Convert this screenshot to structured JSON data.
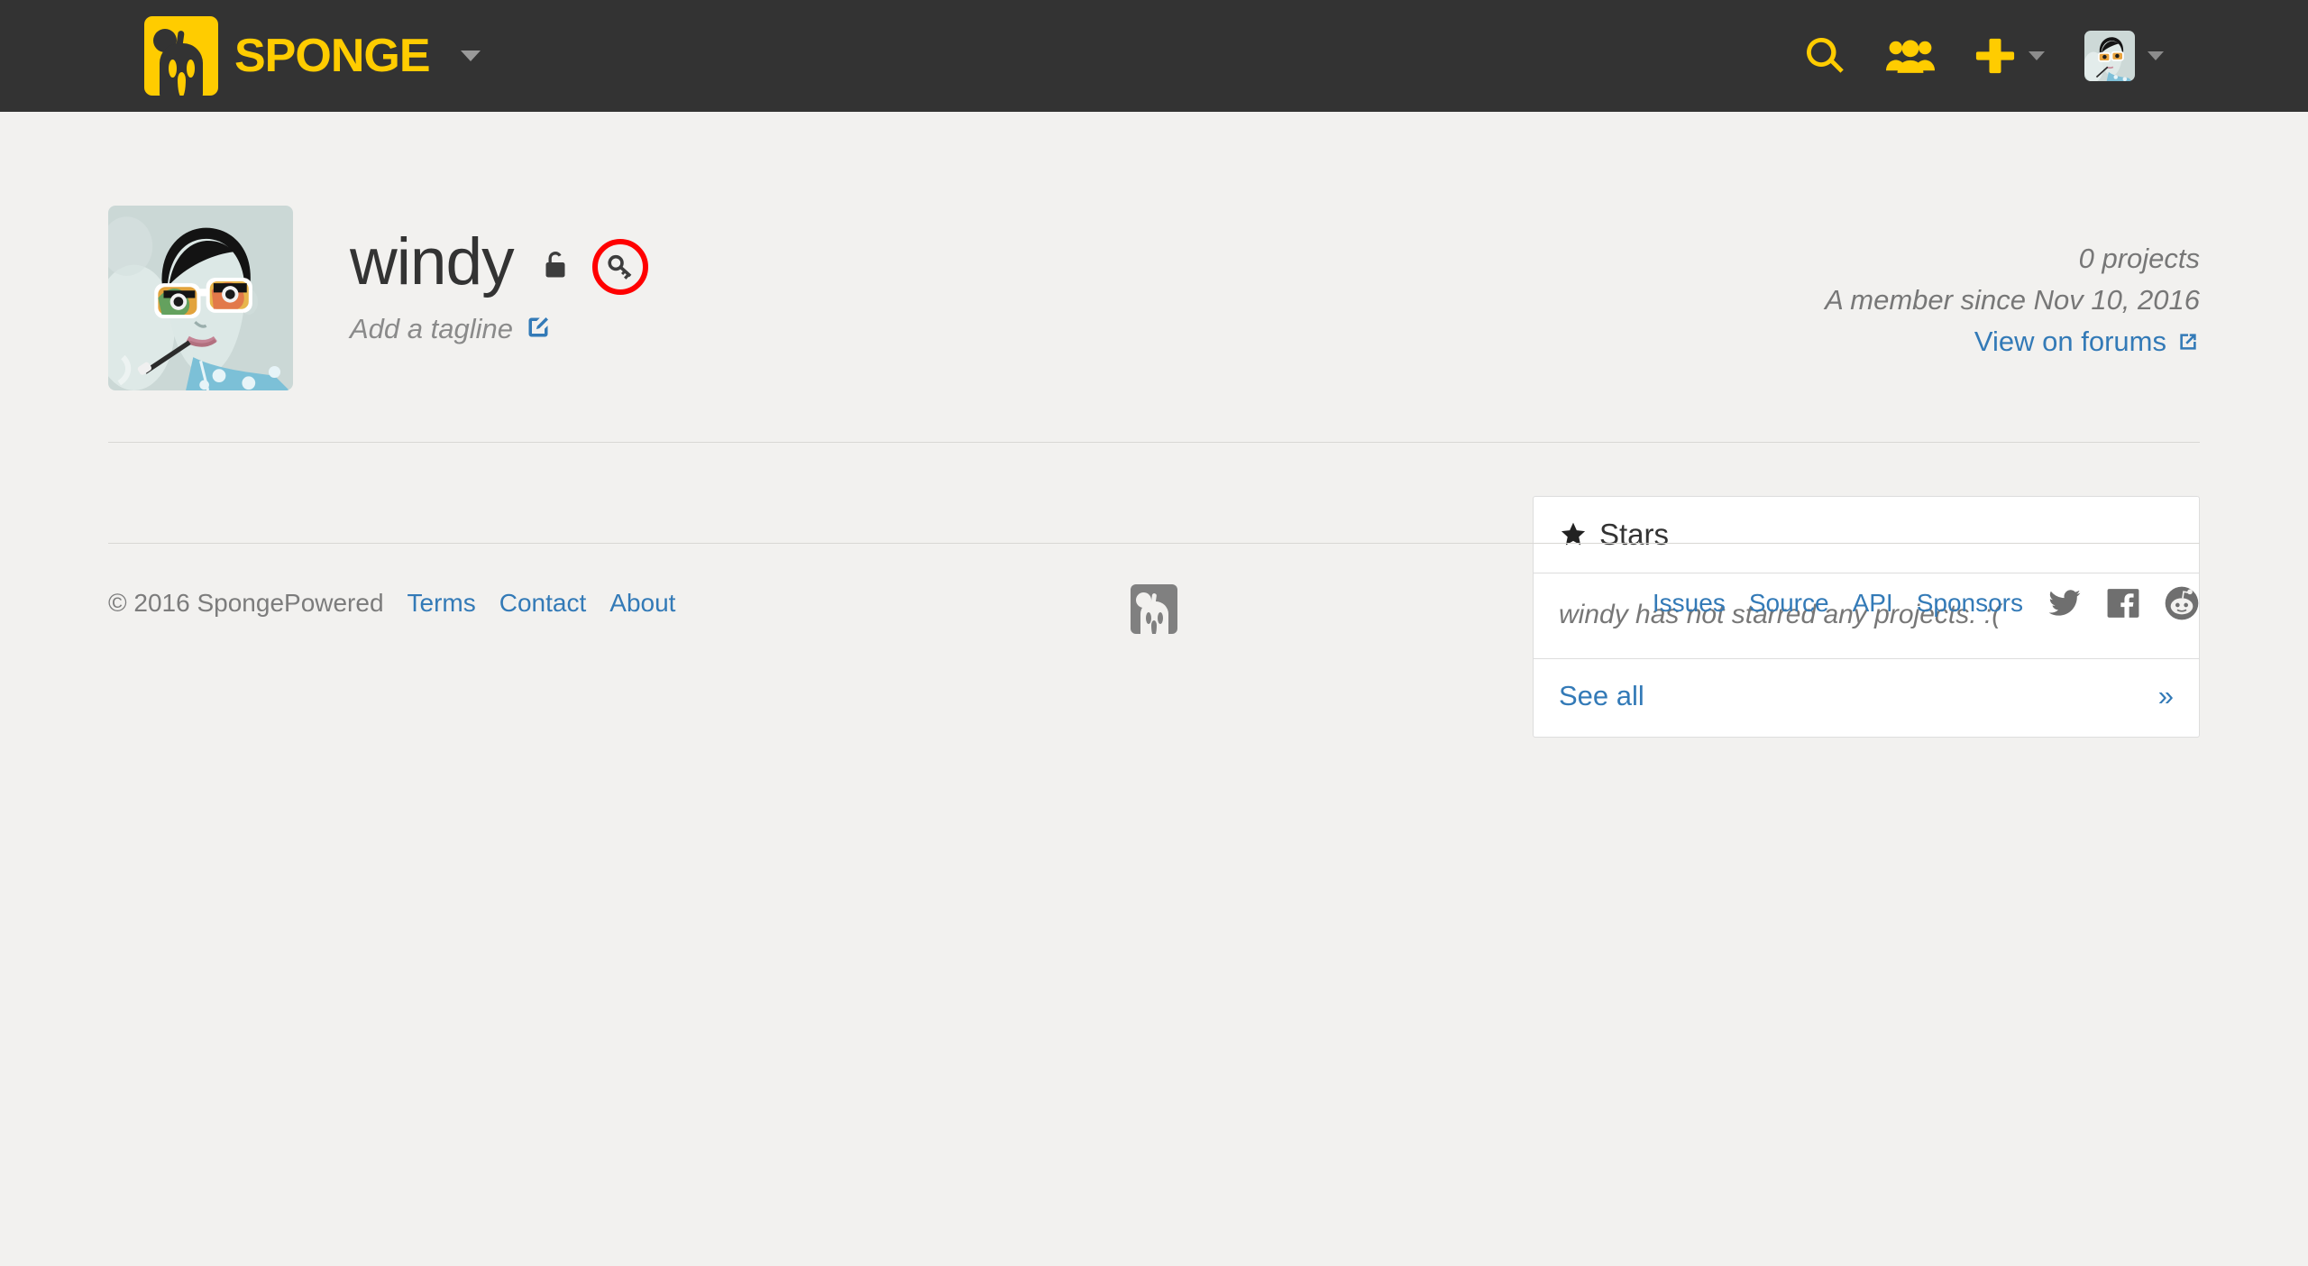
{
  "header": {
    "brand_name": "SPONGE",
    "brand_caret_icon": "chevron-down-icon",
    "search_icon": "search-icon",
    "users_icon": "users-group-icon",
    "plus_icon": "plus-icon",
    "plus_caret_icon": "caret-down-icon",
    "avatar_icon": "user-avatar",
    "avatar_caret_icon": "caret-down-icon",
    "background_color": "#333333",
    "accent_color": "#FFCC00"
  },
  "profile": {
    "avatar_name": "user-avatar-large",
    "username": "windy",
    "visibility_icon": "unlock-icon",
    "key_icon": "key-icon",
    "annotation_color": "#FF0000",
    "tagline_placeholder": "Add a tagline",
    "tagline_edit_icon": "edit-pencil-square-icon",
    "projects_count": "0 projects",
    "member_since": "A member since Nov 10, 2016",
    "forums_link": "View on forums",
    "forums_link_icon": "external-link-icon"
  },
  "stars_panel": {
    "star_icon": "star-icon",
    "title": "Stars",
    "empty_message": "windy has not starred any projects. :(",
    "see_all_label": "See all",
    "more_chevron": "»"
  },
  "footer": {
    "copyright": "© 2016 SpongePowered",
    "left_links": [
      {
        "label": "Terms"
      },
      {
        "label": "Contact"
      },
      {
        "label": "About"
      }
    ],
    "center_logo_icon": "sponge-logo-mark",
    "right_links": [
      {
        "label": "Issues"
      },
      {
        "label": "Source"
      },
      {
        "label": "API"
      },
      {
        "label": "Sponsors"
      }
    ],
    "social": [
      {
        "icon": "twitter-icon"
      },
      {
        "icon": "facebook-icon"
      },
      {
        "icon": "reddit-icon"
      }
    ]
  },
  "colors": {
    "link_blue": "#337AB7",
    "page_background": "#F2F1EF",
    "text_dark": "#333333",
    "text_muted": "#777777"
  }
}
